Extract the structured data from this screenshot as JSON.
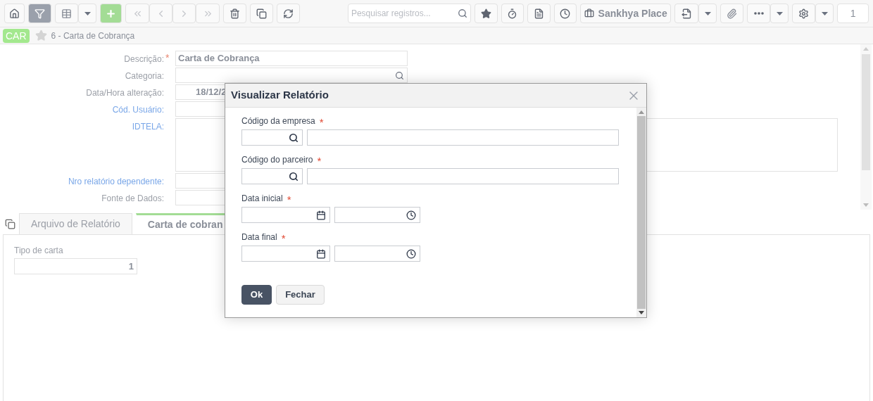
{
  "toolbar": {
    "filter": {
      "selected": true
    },
    "search_placeholder": "Pesquisar registros...",
    "place_label": "Sankhya Place",
    "page_number": "1"
  },
  "header": {
    "badge": "CAR",
    "favorite": false,
    "title": "6 - Carta de Cobrança"
  },
  "form": {
    "fields": [
      {
        "label": "Descrição:",
        "link": false,
        "required_mark": "*",
        "kind": "text",
        "value": "Carta de Cobrança"
      },
      {
        "label": "Categoria:",
        "link": false,
        "kind": "lookup"
      },
      {
        "label": "Data/Hora alteração:",
        "link": false,
        "kind": "datetime",
        "value": "18/12/2"
      },
      {
        "label": "Cód. Usuário:",
        "link": true,
        "kind": "text"
      },
      {
        "label": "IDTELA:",
        "link": true,
        "kind": "textarea"
      },
      {
        "label": "Nro relatório dependente:",
        "link": true,
        "kind": "text"
      },
      {
        "label": "Fonte de Dados:",
        "link": false,
        "kind": "text"
      }
    ]
  },
  "tabs": [
    {
      "label": "Arquivo de Relatório",
      "selected": false
    },
    {
      "label": "Carta de cobran",
      "selected": true
    }
  ],
  "tab_content": {
    "label": "Tipo de carta",
    "value": "1"
  },
  "dialog": {
    "title": "Visualizar Relatório",
    "fields": [
      {
        "label": "Código da empresa",
        "required_mark": "*",
        "kind": "lookup"
      },
      {
        "label": "Código do parceiro",
        "required_mark": "*",
        "kind": "lookup"
      },
      {
        "label": "Data inicial",
        "required_mark": "*",
        "kind": "date"
      },
      {
        "label": "Data final",
        "required_mark": "*",
        "kind": "date"
      }
    ],
    "buttons": [
      {
        "label": "Ok",
        "kind": "primary"
      },
      {
        "label": "Fechar",
        "kind": "secondary"
      }
    ]
  }
}
